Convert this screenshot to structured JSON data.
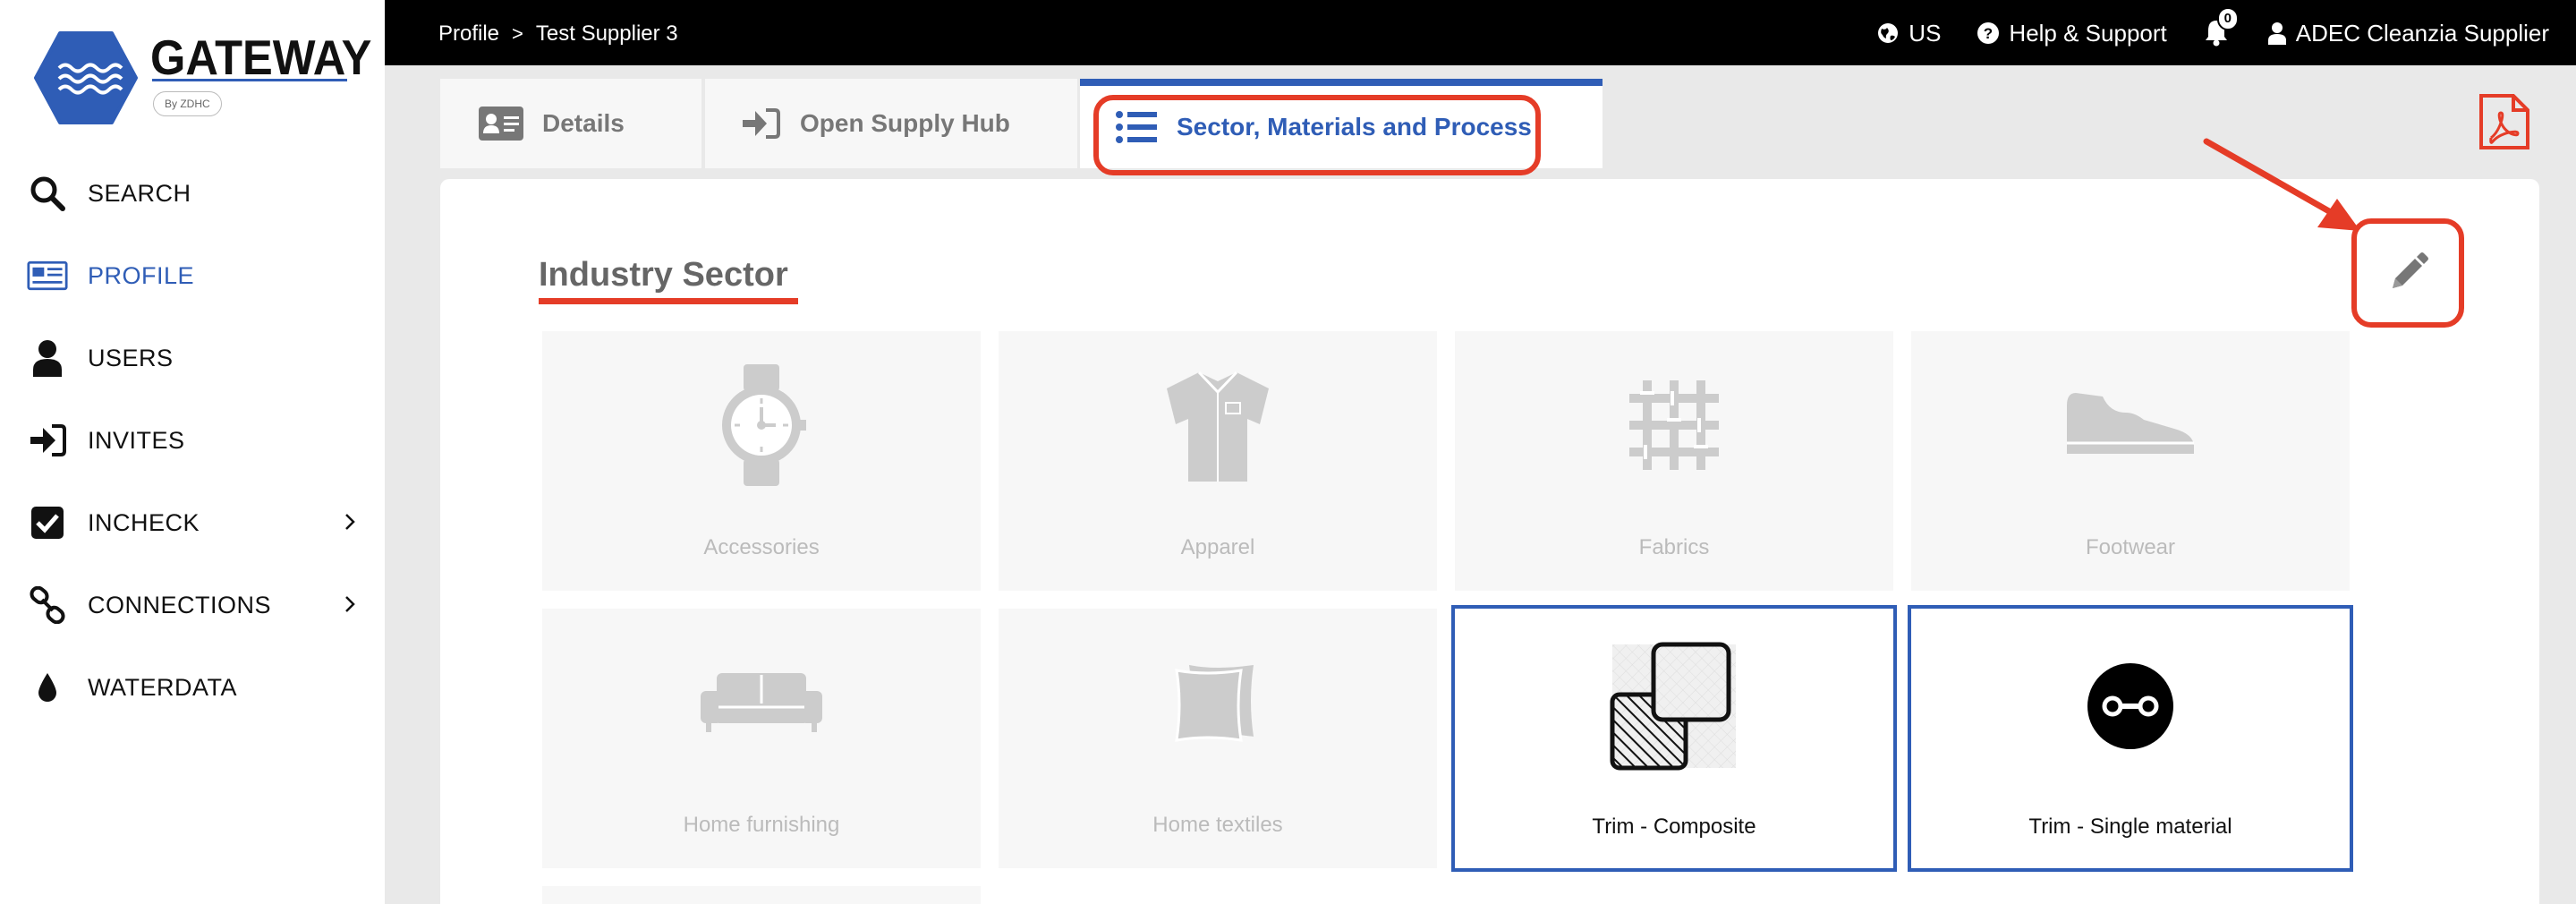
{
  "brand": {
    "title": "GATEWAY",
    "byline": "By ZDHC"
  },
  "sidebar": {
    "items": [
      {
        "label": "SEARCH",
        "icon": "search-icon"
      },
      {
        "label": "PROFILE",
        "icon": "profile-card-icon",
        "active": true
      },
      {
        "label": "USERS",
        "icon": "user-icon"
      },
      {
        "label": "INVITES",
        "icon": "sign-in-icon"
      },
      {
        "label": "INCHECK",
        "icon": "checkbox-icon",
        "has_submenu": true
      },
      {
        "label": "CONNECTIONS",
        "icon": "link-icon",
        "has_submenu": true
      },
      {
        "label": "WATERDATA",
        "icon": "water-drop-icon"
      }
    ]
  },
  "topbar": {
    "breadcrumb": [
      "Profile",
      "Test Supplier 3"
    ],
    "breadcrumb_separator": ">",
    "language": "US",
    "help": "Help & Support",
    "notifications_count": "0",
    "user": "ADEC Cleanzia Supplier"
  },
  "tabs": [
    {
      "label": "Details",
      "icon": "id-card-icon"
    },
    {
      "label": "Open Supply Hub",
      "icon": "sign-in-icon"
    },
    {
      "label": "Sector, Materials and Process",
      "icon": "list-icon",
      "active": true
    }
  ],
  "section": {
    "title": "Industry Sector"
  },
  "sectors": [
    {
      "label": "Accessories",
      "icon": "watch-icon",
      "selected": false
    },
    {
      "label": "Apparel",
      "icon": "shirt-icon",
      "selected": false
    },
    {
      "label": "Fabrics",
      "icon": "fabric-weave-icon",
      "selected": false
    },
    {
      "label": "Footwear",
      "icon": "shoe-icon",
      "selected": false
    },
    {
      "label": "Home furnishing",
      "icon": "sofa-icon",
      "selected": false
    },
    {
      "label": "Home textiles",
      "icon": "pillow-icon",
      "selected": false
    },
    {
      "label": "Trim - Composite",
      "icon": "composite-layers-icon",
      "selected": true
    },
    {
      "label": "Trim - Single material",
      "icon": "single-material-icon",
      "selected": true
    }
  ],
  "colors": {
    "accent": "#2f5db6",
    "highlight": "#e53c27",
    "muted": "#bbbbbb"
  }
}
